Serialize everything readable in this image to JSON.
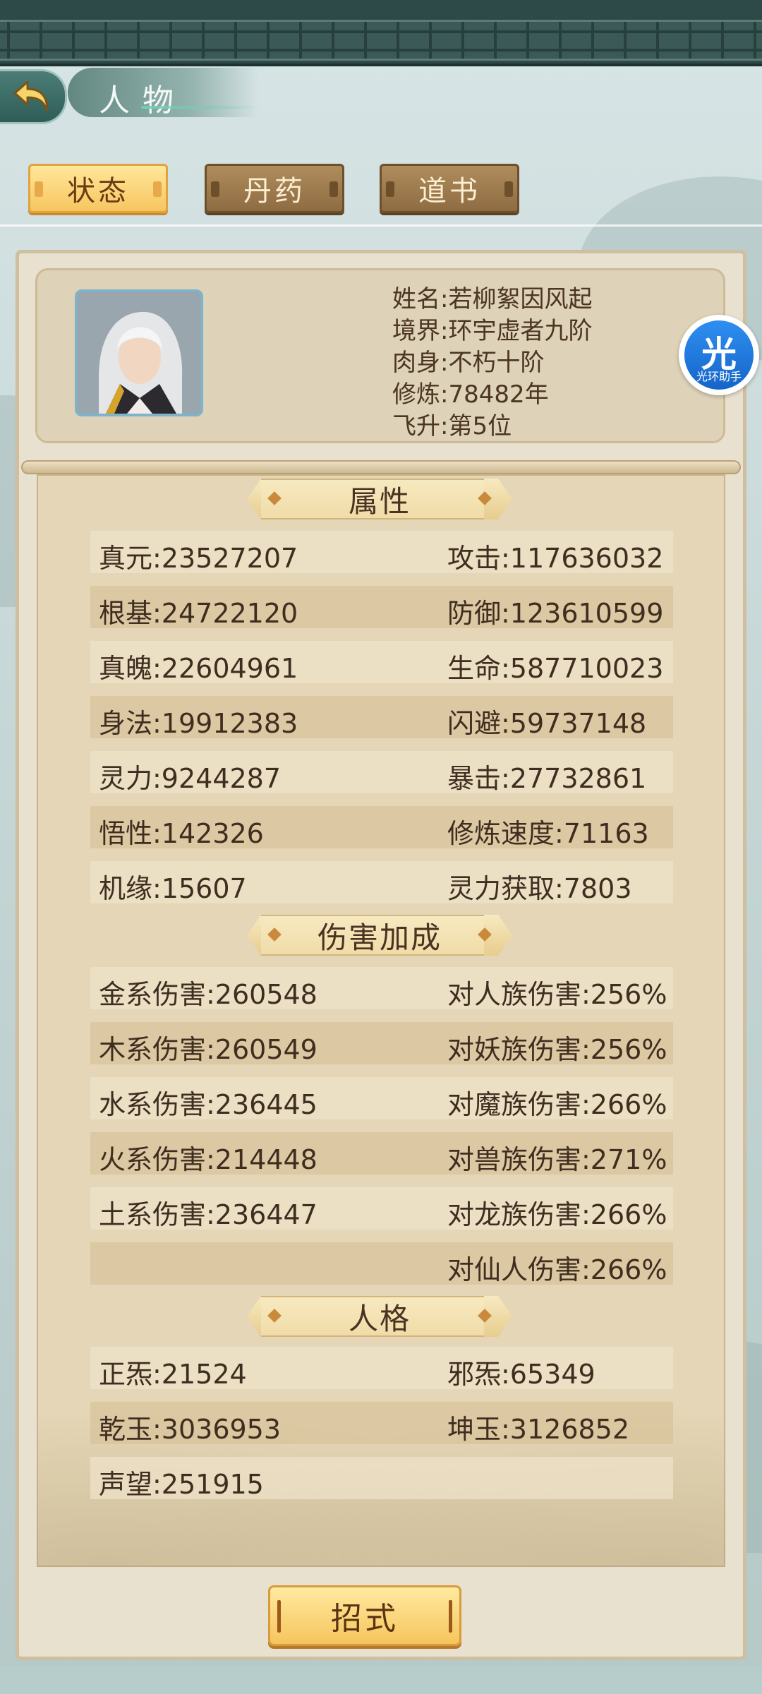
{
  "header": {
    "title": "人物"
  },
  "tabs": [
    {
      "label": "状态",
      "active": true
    },
    {
      "label": "丹药",
      "active": false
    },
    {
      "label": "道书",
      "active": false
    }
  ],
  "character": {
    "name": "姓名:若柳絮因风起",
    "realm": "境界:环宇虚者九阶",
    "body": "肉身:不朽十阶",
    "cultivation": "修炼:78482年",
    "ascension": "飞升:第5位"
  },
  "sections": {
    "attributes": "属性",
    "damage_bonus": "伤害加成",
    "personality": "人格"
  },
  "attributes": [
    [
      "真元:23527207",
      "攻击:117636032"
    ],
    [
      "根基:24722120",
      "防御:123610599"
    ],
    [
      "真魄:22604961",
      "生命:587710023"
    ],
    [
      "身法:19912383",
      "闪避:59737148"
    ],
    [
      "灵力:9244287",
      "暴击:27732861"
    ],
    [
      "悟性:142326",
      "修炼速度:71163"
    ],
    [
      "机缘:15607",
      "灵力获取:7803"
    ]
  ],
  "damage": [
    [
      "金系伤害:260548",
      "对人族伤害:256%"
    ],
    [
      "木系伤害:260549",
      "对妖族伤害:256%"
    ],
    [
      "水系伤害:236445",
      "对魔族伤害:266%"
    ],
    [
      "火系伤害:214448",
      "对兽族伤害:271%"
    ],
    [
      "土系伤害:236447",
      "对龙族伤害:266%"
    ],
    [
      "",
      "对仙人伤害:266%"
    ]
  ],
  "personality": [
    [
      "正炁:21524",
      "邪炁:65349"
    ],
    [
      "乾玉:3036953",
      "坤玉:3126852"
    ],
    [
      "声望:251915",
      ""
    ]
  ],
  "helper": {
    "glyph": "光",
    "label": "光环助手"
  },
  "skill_button": "招式",
  "colors": {
    "accent": "#f6c55d",
    "panel": "#e9e1cf",
    "text": "#3f2d20",
    "frieze": "#2e4a48"
  },
  "icons": {
    "back": "back-arrow-icon"
  }
}
